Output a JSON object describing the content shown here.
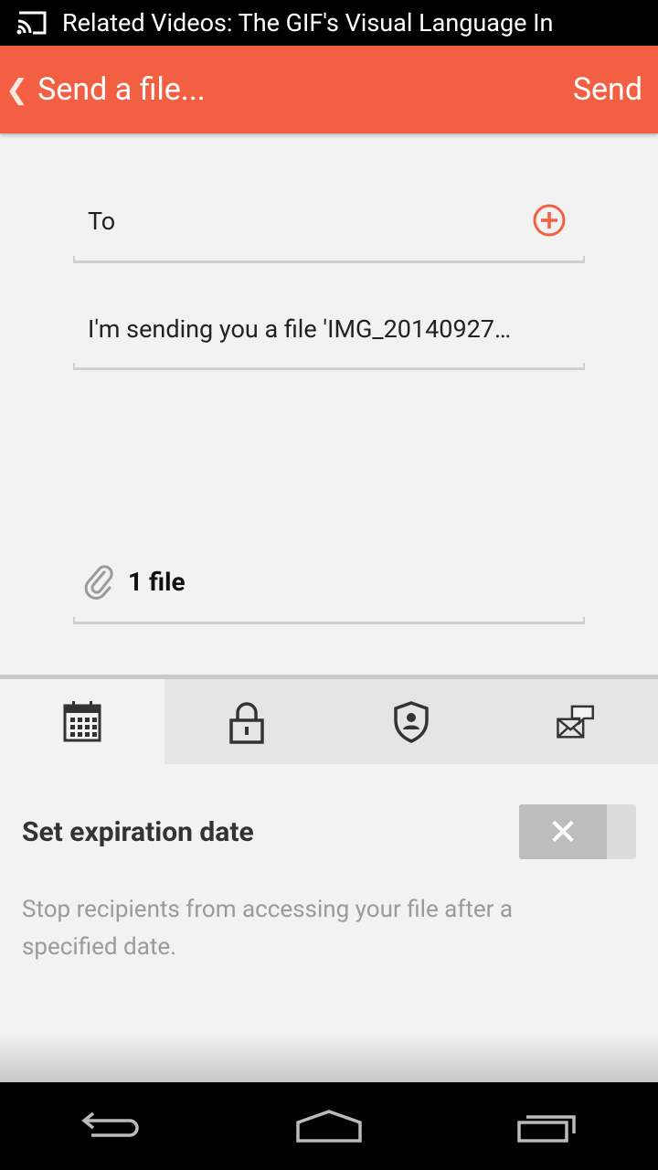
{
  "status_bar": {
    "notification_title": "Related Videos: The GIF's Visual Language In",
    "cast_icon": "cast-icon"
  },
  "action_bar": {
    "back_icon": "chevron-left-icon",
    "title": "Send a file...",
    "send_label": "Send"
  },
  "form": {
    "to_label": "To",
    "add_recipient_icon": "plus-circle-icon",
    "message": "I'm sending you a file 'IMG_20140927…",
    "attachment_icon": "paperclip-icon",
    "file_count": "1 file"
  },
  "tabs": [
    {
      "icon": "calendar-icon",
      "active": true
    },
    {
      "icon": "lock-icon",
      "active": false
    },
    {
      "icon": "shield-user-icon",
      "active": false
    },
    {
      "icon": "envelope-chat-icon",
      "active": false
    }
  ],
  "setting": {
    "title": "Set expiration date",
    "toggle_state": "off",
    "toggle_symbol": "✕",
    "description": "Stop recipients from accessing your file after a specified date."
  },
  "nav_bar": {
    "items": [
      "back-icon",
      "home-icon",
      "recents-icon"
    ]
  },
  "colors": {
    "accent": "#f35f43",
    "background": "#f2f2f2"
  }
}
